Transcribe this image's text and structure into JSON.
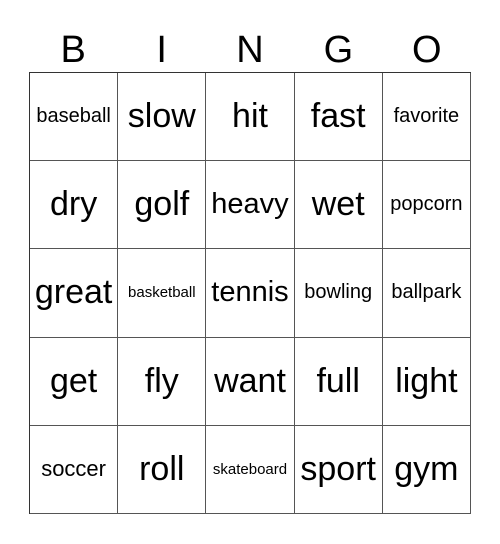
{
  "header": [
    "B",
    "I",
    "N",
    "G",
    "O"
  ],
  "cells": [
    {
      "text": "baseball",
      "size": "s-s"
    },
    {
      "text": "slow",
      "size": "s-xl"
    },
    {
      "text": "hit",
      "size": "s-xl"
    },
    {
      "text": "fast",
      "size": "s-xl"
    },
    {
      "text": "favorite",
      "size": "s-s"
    },
    {
      "text": "dry",
      "size": "s-xl"
    },
    {
      "text": "golf",
      "size": "s-xl"
    },
    {
      "text": "heavy",
      "size": "s-l"
    },
    {
      "text": "wet",
      "size": "s-xl"
    },
    {
      "text": "popcorn",
      "size": "s-s"
    },
    {
      "text": "great",
      "size": "s-xl"
    },
    {
      "text": "basketball",
      "size": "s-xs"
    },
    {
      "text": "tennis",
      "size": "s-l"
    },
    {
      "text": "bowling",
      "size": "s-s"
    },
    {
      "text": "ballpark",
      "size": "s-s"
    },
    {
      "text": "get",
      "size": "s-xl"
    },
    {
      "text": "fly",
      "size": "s-xl"
    },
    {
      "text": "want",
      "size": "s-xl"
    },
    {
      "text": "full",
      "size": "s-xl"
    },
    {
      "text": "light",
      "size": "s-xl"
    },
    {
      "text": "soccer",
      "size": "s-m"
    },
    {
      "text": "roll",
      "size": "s-xl"
    },
    {
      "text": "skateboard",
      "size": "s-xs"
    },
    {
      "text": "sport",
      "size": "s-xl"
    },
    {
      "text": "gym",
      "size": "s-xl"
    }
  ]
}
